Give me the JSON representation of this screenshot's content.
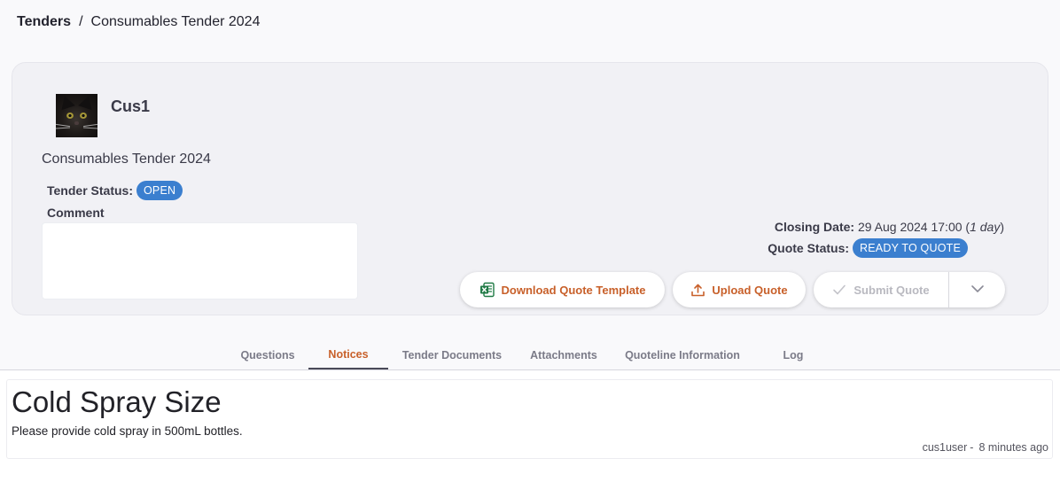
{
  "breadcrumb": {
    "root": "Tenders",
    "separator": "/",
    "current": "Consumables Tender 2024"
  },
  "card": {
    "username": "Cus1",
    "tender_name": "Consumables Tender 2024",
    "tender_status_label": "Tender Status:",
    "tender_status_value": "OPEN",
    "comment_label": "Comment",
    "comment_value": "",
    "closing_date_label": "Closing Date:",
    "closing_date_value": "29 Aug 2024 17:00",
    "closing_date_open_paren": "(",
    "closing_date_relative": "1 day",
    "closing_date_close_paren": ")",
    "quote_status_label": "Quote Status:",
    "quote_status_value": "READY TO QUOTE"
  },
  "actions": {
    "download_label": "Download Quote Template",
    "upload_label": "Upload Quote",
    "submit_label": "Submit Quote"
  },
  "tabs": [
    {
      "label": "Questions"
    },
    {
      "label": "Notices"
    },
    {
      "label": "Tender Documents"
    },
    {
      "label": "Attachments"
    },
    {
      "label": "Quoteline Information"
    },
    {
      "label": "Log"
    }
  ],
  "active_tab": "Notices",
  "notice": {
    "title": "Cold Spray Size",
    "body": "Please provide cold spray in 500mL bottles.",
    "author": "cus1user",
    "separator": "-",
    "time": "8 minutes ago"
  },
  "colors": {
    "accent_orange": "#c8602a",
    "badge_blue": "#3b7fcf",
    "excel_green": "#1f7a45"
  },
  "icons": {
    "download": "excel-file-icon",
    "upload": "upload-icon",
    "submit": "check-icon",
    "dropdown": "chevron-down-icon"
  }
}
